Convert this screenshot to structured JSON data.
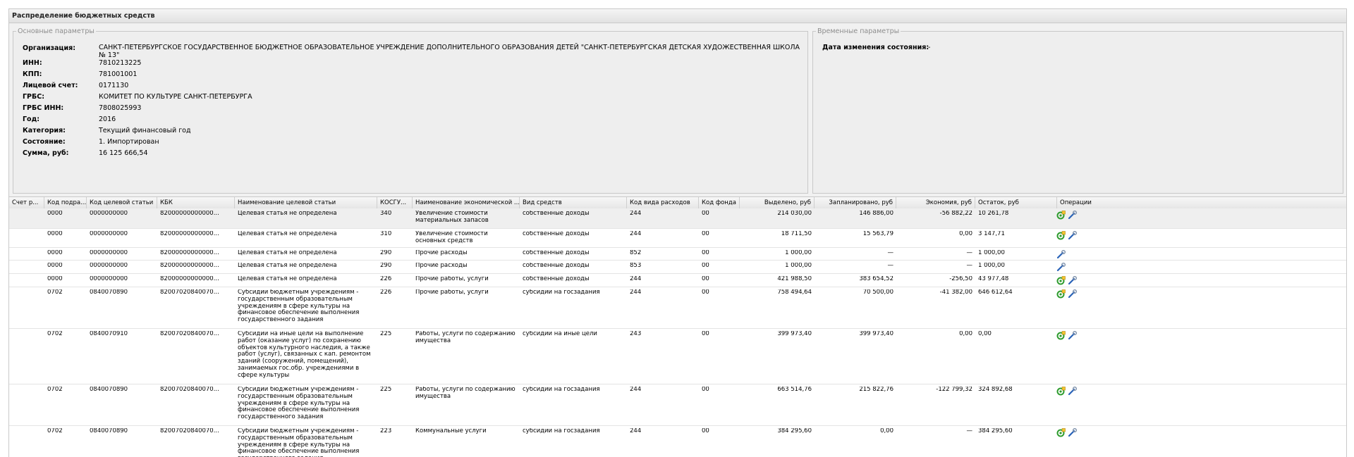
{
  "panel_title": "Распределение бюджетных средств",
  "main_params": {
    "legend": "Основные параметры",
    "fields": [
      {
        "label": "Организация:",
        "value": "САНКТ-ПЕТЕРБУРГСКОЕ ГОСУДАРСТВЕННОЕ БЮДЖЕТНОЕ ОБРАЗОВАТЕЛЬНОЕ УЧРЕЖДЕНИЕ ДОПОЛНИТЕЛЬНОГО ОБРАЗОВАНИЯ ДЕТЕЙ \"САНКТ-ПЕТЕРБУРГСКАЯ ДЕТСКАЯ ХУДОЖЕСТВЕННАЯ ШКОЛА № 13\""
      },
      {
        "label": "ИНН:",
        "value": "7810213225"
      },
      {
        "label": "КПП:",
        "value": "781001001"
      },
      {
        "label": "Лицевой счет:",
        "value": "0171130"
      },
      {
        "label": "ГРБС:",
        "value": "КОМИТЕТ ПО КУЛЬТУРЕ САНКТ-ПЕТЕРБУРГА"
      },
      {
        "label": "ГРБС ИНН:",
        "value": "7808025993"
      },
      {
        "label": "Год:",
        "value": "2016"
      },
      {
        "label": "Категория:",
        "value": "Текущий финансовый год"
      },
      {
        "label": "Состояние:",
        "value": "1. Импортирован"
      },
      {
        "label": "Сумма, руб:",
        "value": "16 125 666,54"
      }
    ]
  },
  "time_params": {
    "legend": "Временные параметры",
    "fields": [
      {
        "label": "Дата изменения состояния:",
        "value": "-"
      }
    ]
  },
  "grid": {
    "columns": [
      "Счет р...",
      "Код подра...",
      "Код целевой статьи",
      "КБК",
      "Наименование целевой статьи",
      "КОСГУ...",
      "Наименование экономической ...",
      "Вид средств",
      "Код вида расходов",
      "Код фонда",
      "Выделено, руб",
      "Запланировано, руб",
      "Экономия, руб",
      "Остаток, руб",
      "Операции"
    ],
    "rows": [
      {
        "schet": "",
        "kod_podr": "0000",
        "kod_cs": "0000000000",
        "kbk": "82000000000000...",
        "name_cs": "Целевая статья не определена",
        "kosgu": "340",
        "name_econ": "Увеличение стоимости материальных запасов",
        "vid": "собственные доходы",
        "kvr": "244",
        "fond": "00",
        "vydeleno": "214 030,00",
        "zapl": "146 886,00",
        "econ": "-56 882,22",
        "ostatok": "10 261,78",
        "ops": [
          "add",
          "edit"
        ]
      },
      {
        "schet": "",
        "kod_podr": "0000",
        "kod_cs": "0000000000",
        "kbk": "82000000000000...",
        "name_cs": "Целевая статья не определена",
        "kosgu": "310",
        "name_econ": "Увеличение стоимости основных средств",
        "vid": "собственные доходы",
        "kvr": "244",
        "fond": "00",
        "vydeleno": "18 711,50",
        "zapl": "15 563,79",
        "econ": "0,00",
        "ostatok": "3 147,71",
        "ops": [
          "add",
          "edit"
        ]
      },
      {
        "schet": "",
        "kod_podr": "0000",
        "kod_cs": "0000000000",
        "kbk": "82000000000000...",
        "name_cs": "Целевая статья не определена",
        "kosgu": "290",
        "name_econ": "Прочие расходы",
        "vid": "собственные доходы",
        "kvr": "852",
        "fond": "00",
        "vydeleno": "1 000,00",
        "zapl": "—",
        "econ": "—",
        "ostatok": "1 000,00",
        "ops": [
          "edit"
        ]
      },
      {
        "schet": "",
        "kod_podr": "0000",
        "kod_cs": "0000000000",
        "kbk": "82000000000000...",
        "name_cs": "Целевая статья не определена",
        "kosgu": "290",
        "name_econ": "Прочие расходы",
        "vid": "собственные доходы",
        "kvr": "853",
        "fond": "00",
        "vydeleno": "1 000,00",
        "zapl": "—",
        "econ": "—",
        "ostatok": "1 000,00",
        "ops": [
          "edit"
        ]
      },
      {
        "schet": "",
        "kod_podr": "0000",
        "kod_cs": "0000000000",
        "kbk": "82000000000000...",
        "name_cs": "Целевая статья не определена",
        "kosgu": "226",
        "name_econ": "Прочие работы, услуги",
        "vid": "собственные доходы",
        "kvr": "244",
        "fond": "00",
        "vydeleno": "421 988,50",
        "zapl": "383 654,52",
        "econ": "-256,50",
        "ostatok": "43 977,48",
        "ops": [
          "add",
          "edit"
        ]
      },
      {
        "schet": "",
        "kod_podr": "0702",
        "kod_cs": "0840070890",
        "kbk": "82007020840070...",
        "name_cs": "Субсидии бюджетным учреждениям - государственным образовательным учреждениям в сфере культуры на финансовое обеспечение выполнения государственного задания",
        "kosgu": "226",
        "name_econ": "Прочие работы, услуги",
        "vid": "субсидии на госзадания",
        "kvr": "244",
        "fond": "00",
        "vydeleno": "758 494,64",
        "zapl": "70 500,00",
        "econ": "-41 382,00",
        "ostatok": "646 612,64",
        "ops": [
          "add",
          "edit"
        ]
      },
      {
        "schet": "",
        "kod_podr": "0702",
        "kod_cs": "0840070910",
        "kbk": "82007020840070...",
        "name_cs": "Субсидии на иные цели на выполнение работ (оказание услуг) по сохранению объектов культурного наследия, а также работ (услуг), связанных с кап. ремонтом зданий (сооружений, помещений), занимаемых гос.обр. учреждениями в сфере культуры",
        "kosgu": "225",
        "name_econ": "Работы, услуги по содержанию имущества",
        "vid": "субсидии на иные цели",
        "kvr": "243",
        "fond": "00",
        "vydeleno": "399 973,40",
        "zapl": "399 973,40",
        "econ": "0,00",
        "ostatok": "0,00",
        "ops": [
          "add",
          "edit"
        ]
      },
      {
        "schet": "",
        "kod_podr": "0702",
        "kod_cs": "0840070890",
        "kbk": "82007020840070...",
        "name_cs": "Субсидии бюджетным учреждениям - государственным образовательным учреждениям в сфере культуры на финансовое обеспечение выполнения государственного задания",
        "kosgu": "225",
        "name_econ": "Работы, услуги по содержанию имущества",
        "vid": "субсидии на госзадания",
        "kvr": "244",
        "fond": "00",
        "vydeleno": "663 514,76",
        "zapl": "215 822,76",
        "econ": "-122 799,32",
        "ostatok": "324 892,68",
        "ops": [
          "add",
          "edit"
        ]
      },
      {
        "schet": "",
        "kod_podr": "0702",
        "kod_cs": "0840070890",
        "kbk": "82007020840070...",
        "name_cs": "Субсидии бюджетным учреждениям - государственным образовательным учреждениям в сфере культуры на финансовое обеспечение выполнения государственного задания",
        "kosgu": "223",
        "name_econ": "Коммунальные услуги",
        "vid": "субсидии на госзадания",
        "kvr": "244",
        "fond": "00",
        "vydeleno": "384 295,60",
        "zapl": "0,00",
        "econ": "—",
        "ostatok": "384 295,60",
        "ops": [
          "add",
          "edit"
        ]
      }
    ]
  },
  "colors": {
    "add_icon": "#2e9c2e",
    "edit_icon": "#2a63b8"
  },
  "icons": {
    "add": "add-row-icon",
    "edit": "edit-wrench-icon"
  }
}
